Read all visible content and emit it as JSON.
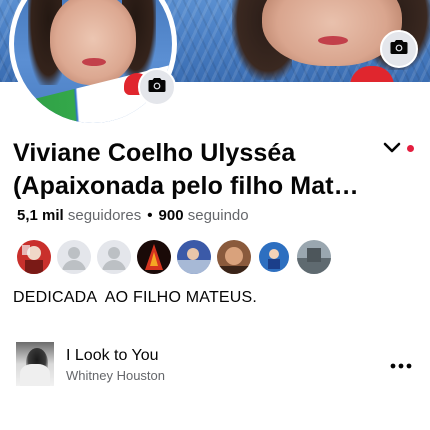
{
  "profile": {
    "name_line1": "Viviane Coelho Ulysséa",
    "name_line2": "(Apaixonada pelo filho Mat…",
    "bio": "DEDICADA  AO FILHO MATEUS."
  },
  "stats": {
    "followers_count": "5,1 mil",
    "followers_label": "seguidores",
    "separator": "•",
    "following_count": "900",
    "following_label": "seguindo"
  },
  "icons": {
    "cover_camera": "camera-icon",
    "avatar_camera": "camera-icon",
    "more_options": "chevron-down-icon",
    "music_more": "more-horizontal-icon"
  },
  "friends": [
    {
      "name": "friend-avatar-1",
      "kind": "photo",
      "color": "#c9302c"
    },
    {
      "name": "friend-avatar-2",
      "kind": "placeholder",
      "color": "#bcc0c4"
    },
    {
      "name": "friend-avatar-3",
      "kind": "placeholder",
      "color": "#bcc0c4"
    },
    {
      "name": "friend-avatar-4",
      "kind": "photo",
      "color": "#b8241b"
    },
    {
      "name": "friend-avatar-5",
      "kind": "photo",
      "color": "#3b5aa8"
    },
    {
      "name": "friend-avatar-6",
      "kind": "photo",
      "color": "#8a5a3c"
    },
    {
      "name": "friend-avatar-7",
      "kind": "photo",
      "color": "#2d6fc0"
    },
    {
      "name": "friend-avatar-8",
      "kind": "photo",
      "color": "#6f7a80"
    }
  ],
  "music": {
    "song_title": "I Look to You",
    "artist": "Whitney Houston"
  },
  "colors": {
    "primary_text": "#050505",
    "secondary_text": "#65676b",
    "notification_dot": "#e41e3f",
    "button_bg": "#e4e6eb"
  }
}
